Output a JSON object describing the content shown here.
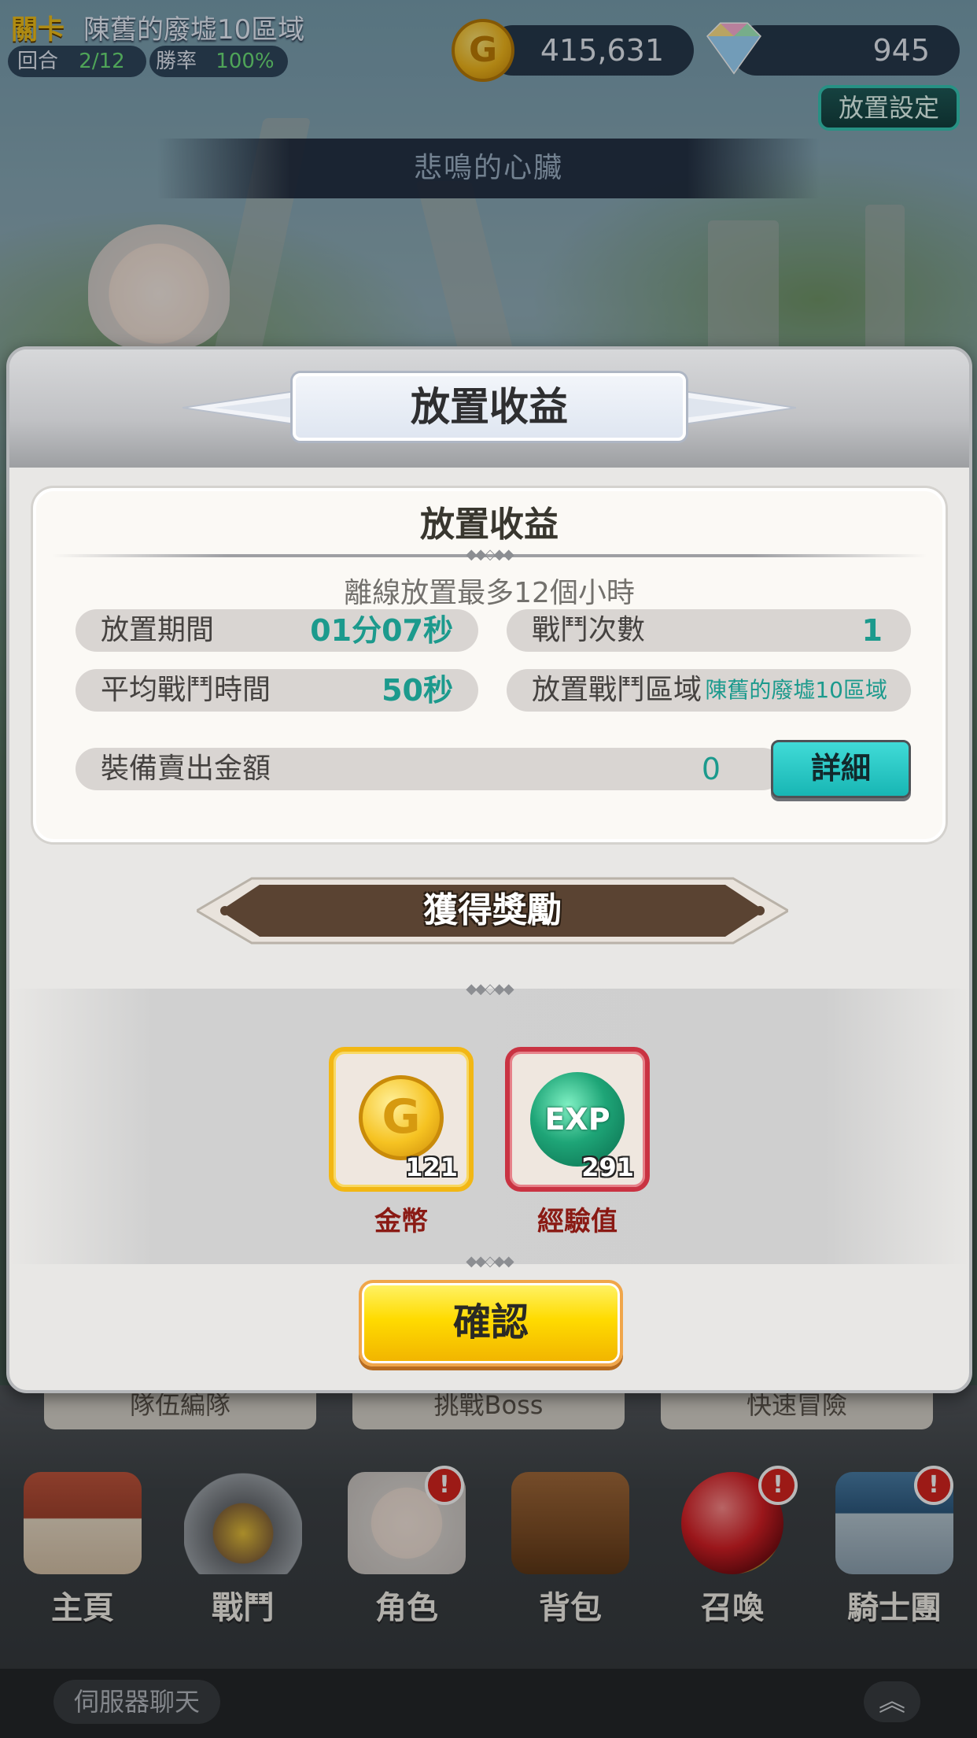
{
  "hud": {
    "stage_tag": "關卡",
    "stage_name": "陳舊的廢墟10區域",
    "round_label": "回合",
    "round_value": "2/12",
    "winrate_label": "勝率",
    "winrate_value": "100%",
    "gold": "415,631",
    "gems": "945",
    "gold_icon_glyph": "G",
    "idle_settings_button": "放置設定",
    "song_title": "悲鳴的心臟"
  },
  "modal": {
    "title": "放置收益",
    "card_title": "放置收益",
    "note": "離線放置最多12個小時",
    "stats": {
      "idle_duration_label": "放置期間",
      "idle_duration_value": "01分07秒",
      "battle_count_label": "戰鬥次數",
      "battle_count_value": "1",
      "avg_battle_label": "平均戰鬥時間",
      "avg_battle_value": "50秒",
      "battle_area_label": "放置戰鬥區域",
      "battle_area_value": "陳舊的廢墟10區域",
      "sold_gear_label": "裝備賣出金額",
      "sold_gear_value": "0"
    },
    "detail_button": "詳細",
    "rewards_title": "獲得獎勵",
    "rewards": [
      {
        "name": "金幣",
        "qty": "121",
        "icon": "gold-coin-icon",
        "glyph": "G"
      },
      {
        "name": "經驗值",
        "qty": "291",
        "icon": "exp-orb-icon",
        "glyph": "EXP"
      }
    ],
    "confirm_button": "確認"
  },
  "tabs": [
    "隊伍編隊",
    "挑戰Boss",
    "快速冒險"
  ],
  "nav": [
    {
      "label": "主頁",
      "icon": "house-icon",
      "badge": false
    },
    {
      "label": "戰鬥",
      "icon": "crossed-swords-icon",
      "badge": false
    },
    {
      "label": "角色",
      "icon": "character-icon",
      "badge": true
    },
    {
      "label": "背包",
      "icon": "bag-icon",
      "badge": false
    },
    {
      "label": "召喚",
      "icon": "summon-orb-icon",
      "badge": true
    },
    {
      "label": "騎士團",
      "icon": "castle-icon",
      "badge": true
    }
  ],
  "badge_glyph": "!",
  "chat": {
    "label": "伺服器聊天",
    "arrow": "︽"
  },
  "colors": {
    "accent_teal": "#1c9a8d",
    "confirm_yellow": "#ffdb00",
    "reward_label": "#8a1a14"
  }
}
